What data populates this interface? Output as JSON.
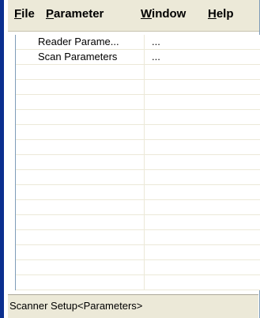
{
  "menubar": {
    "items": [
      {
        "mnemonic": "F",
        "rest": "ile"
      },
      {
        "mnemonic": "P",
        "rest": "arameter"
      },
      {
        "mnemonic": "W",
        "rest": "indow"
      },
      {
        "mnemonic": "H",
        "rest": "elp"
      }
    ]
  },
  "list": {
    "rows": [
      {
        "name": "Reader Parame...",
        "value": "..."
      },
      {
        "name": "Scan Parameters",
        "value": "..."
      }
    ]
  },
  "statusbar": {
    "text": "Scanner Setup<Parameters>"
  }
}
